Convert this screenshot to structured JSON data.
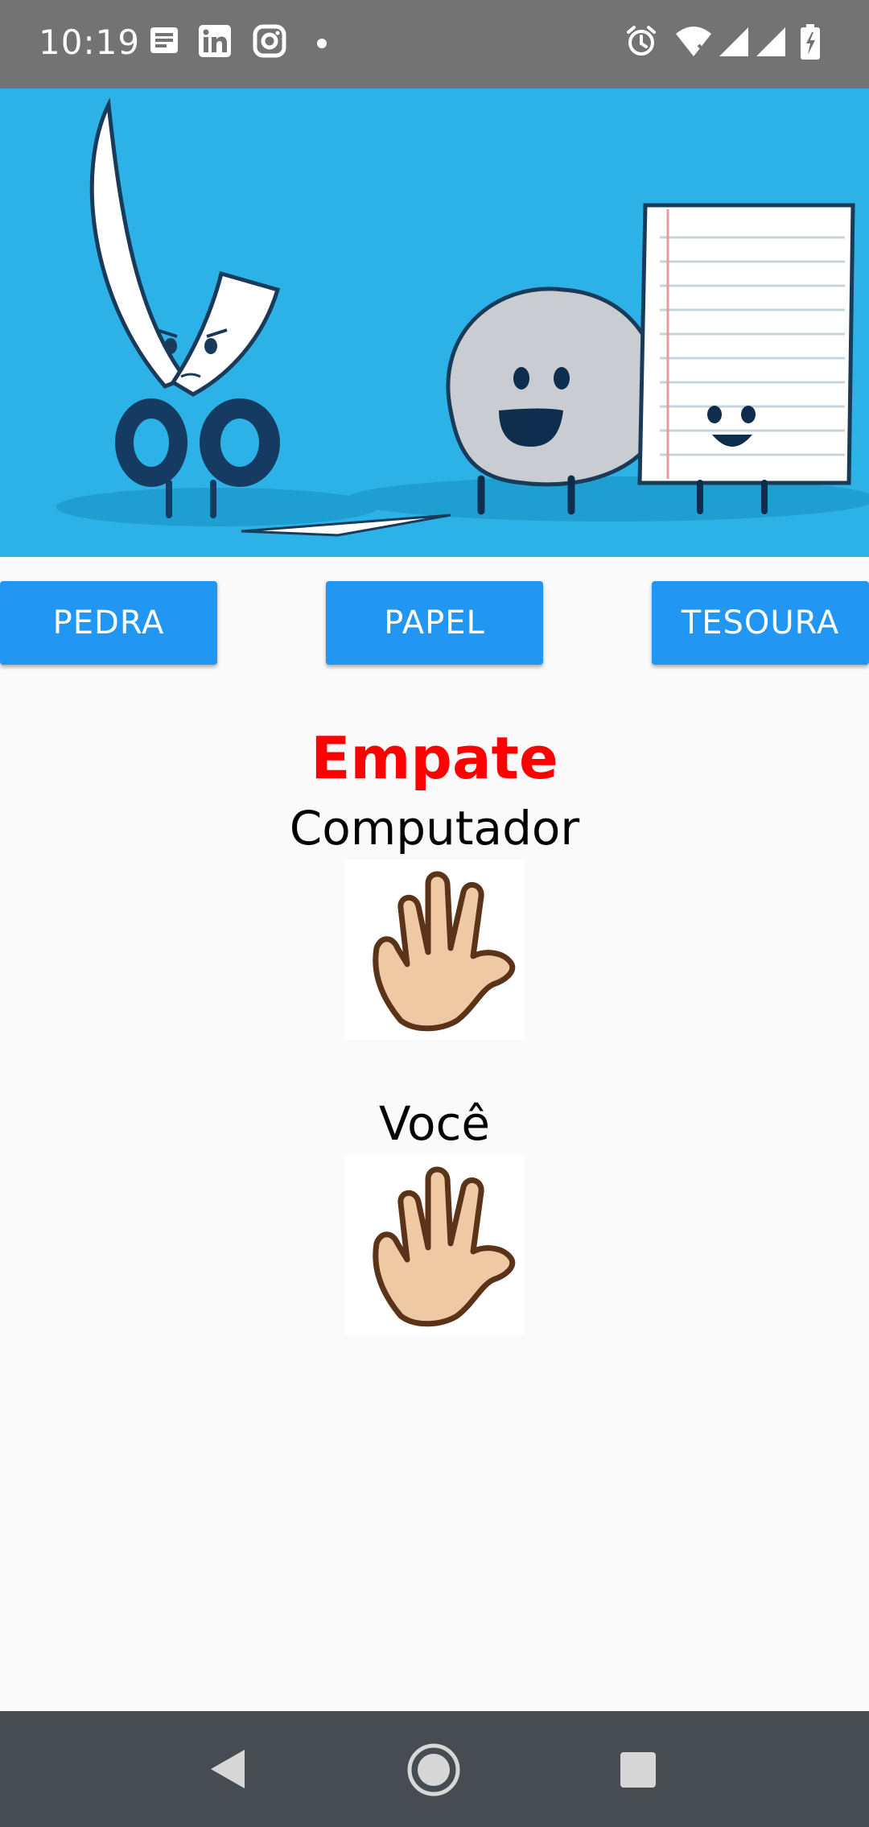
{
  "status_bar": {
    "time": "10:19",
    "left_icons": [
      "notes-icon",
      "linkedin-icon",
      "instagram-icon",
      "dot-icon"
    ],
    "right_icons": [
      "alarm-icon",
      "wifi-icon",
      "signal-icon",
      "signal-icon-2",
      "battery-icon"
    ]
  },
  "banner": {
    "image": "rock-paper-scissors-illustration"
  },
  "buttons": {
    "pedra": "PEDRA",
    "papel": "PAPEL",
    "tesoura": "TESOURA"
  },
  "result": {
    "text": "Empate",
    "color": "#ff0000"
  },
  "computer": {
    "label": "Computador",
    "choice_icon": "paper-hand-icon"
  },
  "player": {
    "label": "Você",
    "choice_icon": "paper-hand-icon"
  },
  "nav_bar": {
    "icons": [
      "back-icon",
      "home-icon",
      "recents-icon"
    ]
  },
  "colors": {
    "accent": "#2196f3",
    "banner": "#2cb2e6",
    "statusbar": "#737373",
    "navbar": "#464c51"
  }
}
